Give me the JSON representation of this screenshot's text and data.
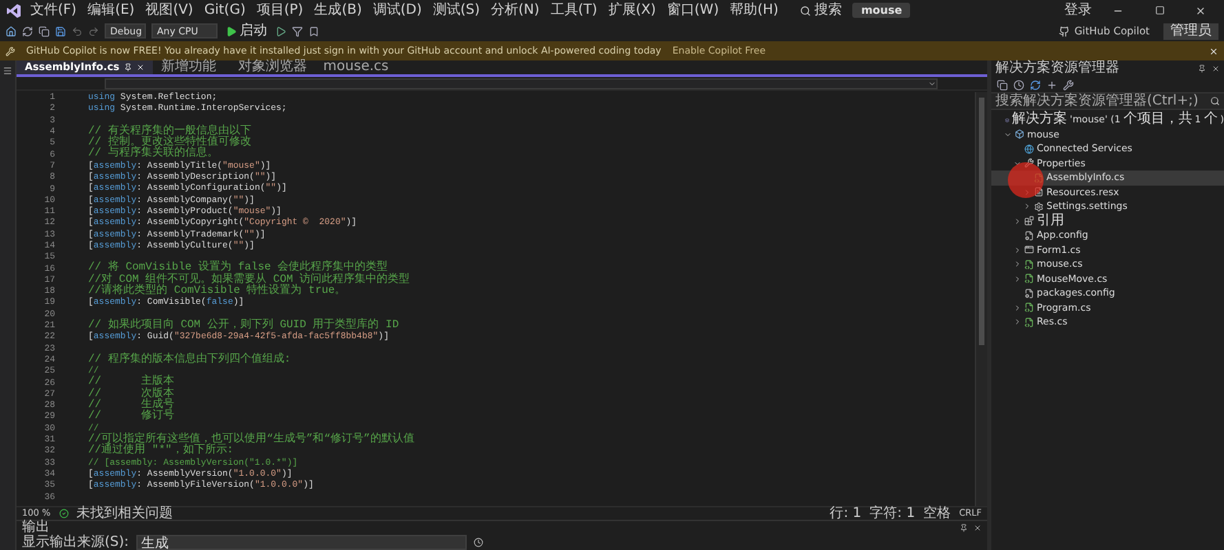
{
  "title_bar": {
    "menus": [
      "文件(F)",
      "编辑(E)",
      "视图(V)",
      "Git(G)",
      "项目(P)",
      "生成(B)",
      "调试(D)",
      "测试(S)",
      "分析(N)",
      "工具(T)",
      "扩展(X)",
      "窗口(W)",
      "帮助(H)"
    ],
    "search": "搜索",
    "solution_name": "mouse",
    "sign_in": "登录"
  },
  "toolbar": {
    "configuration": "Debug",
    "platform": "Any CPU",
    "start": "启动",
    "copilot": "GitHub Copilot",
    "admin": "管理员"
  },
  "banner": {
    "message": "GitHub Copilot is now FREE! You already have it installed just sign in with your GitHub account and unlock AI-powered coding today",
    "link": "Enable Copilot Free"
  },
  "editor": {
    "tabs": [
      {
        "label": "AssemblyInfo.cs",
        "selected": true
      },
      {
        "label": "新增功能",
        "selected": false
      },
      {
        "label": "对象浏览器",
        "selected": false
      },
      {
        "label": "mouse.cs",
        "selected": false
      }
    ],
    "lines": [
      {
        "number": "1",
        "segments": [
          {
            "kind": "keyword",
            "text": "using"
          },
          {
            "kind": "plain",
            "text": " System.Reflection;"
          }
        ]
      },
      {
        "number": "2",
        "segments": [
          {
            "kind": "keyword",
            "text": "using"
          },
          {
            "kind": "plain",
            "text": " System.Runtime.InteropServices;"
          }
        ]
      },
      {
        "number": "3"
      },
      {
        "number": "4",
        "segments": [
          {
            "kind": "comment",
            "text": "// 有关程序集的一般信息由以下"
          }
        ]
      },
      {
        "number": "5",
        "segments": [
          {
            "kind": "comment",
            "text": "// 控制。更改这些特性值可修改"
          }
        ]
      },
      {
        "number": "6",
        "segments": [
          {
            "kind": "comment",
            "text": "// 与程序集关联的信息。"
          }
        ]
      },
      {
        "number": "7",
        "segments": [
          {
            "kind": "plain",
            "text": "["
          },
          {
            "kind": "keyword",
            "text": "assembly"
          },
          {
            "kind": "plain",
            "text": ": AssemblyTitle("
          },
          {
            "kind": "string",
            "text": "\"mouse\""
          },
          {
            "kind": "plain",
            "text": ")]"
          }
        ]
      },
      {
        "number": "8",
        "segments": [
          {
            "kind": "plain",
            "text": "["
          },
          {
            "kind": "keyword",
            "text": "assembly"
          },
          {
            "kind": "plain",
            "text": ": AssemblyDescription("
          },
          {
            "kind": "string",
            "text": "\"\""
          },
          {
            "kind": "plain",
            "text": ")]"
          }
        ]
      },
      {
        "number": "9",
        "segments": [
          {
            "kind": "plain",
            "text": "["
          },
          {
            "kind": "keyword",
            "text": "assembly"
          },
          {
            "kind": "plain",
            "text": ": AssemblyConfiguration("
          },
          {
            "kind": "string",
            "text": "\"\""
          },
          {
            "kind": "plain",
            "text": ")]"
          }
        ]
      },
      {
        "number": "10",
        "segments": [
          {
            "kind": "plain",
            "text": "["
          },
          {
            "kind": "keyword",
            "text": "assembly"
          },
          {
            "kind": "plain",
            "text": ": AssemblyCompany("
          },
          {
            "kind": "string",
            "text": "\"\""
          },
          {
            "kind": "plain",
            "text": ")]"
          }
        ]
      },
      {
        "number": "11",
        "segments": [
          {
            "kind": "plain",
            "text": "["
          },
          {
            "kind": "keyword",
            "text": "assembly"
          },
          {
            "kind": "plain",
            "text": ": AssemblyProduct("
          },
          {
            "kind": "string",
            "text": "\"mouse\""
          },
          {
            "kind": "plain",
            "text": ")]"
          }
        ]
      },
      {
        "number": "12",
        "segments": [
          {
            "kind": "plain",
            "text": "["
          },
          {
            "kind": "keyword",
            "text": "assembly"
          },
          {
            "kind": "plain",
            "text": ": AssemblyCopyright("
          },
          {
            "kind": "string",
            "text": "\"Copyright ©  2020\""
          },
          {
            "kind": "plain",
            "text": ")]"
          }
        ]
      },
      {
        "number": "13",
        "segments": [
          {
            "kind": "plain",
            "text": "["
          },
          {
            "kind": "keyword",
            "text": "assembly"
          },
          {
            "kind": "plain",
            "text": ": AssemblyTrademark("
          },
          {
            "kind": "string",
            "text": "\"\""
          },
          {
            "kind": "plain",
            "text": ")]"
          }
        ]
      },
      {
        "number": "14",
        "segments": [
          {
            "kind": "plain",
            "text": "["
          },
          {
            "kind": "keyword",
            "text": "assembly"
          },
          {
            "kind": "plain",
            "text": ": AssemblyCulture("
          },
          {
            "kind": "string",
            "text": "\"\""
          },
          {
            "kind": "plain",
            "text": ")]"
          }
        ]
      },
      {
        "number": "15"
      },
      {
        "number": "16",
        "segments": [
          {
            "kind": "comment",
            "text": "// 将 ComVisible 设置为 false 会使此程序集中的类型"
          }
        ]
      },
      {
        "number": "17",
        "segments": [
          {
            "kind": "comment",
            "text": "//对 COM 组件不可见。如果需要从 COM 访问此程序集中的类型"
          }
        ]
      },
      {
        "number": "18",
        "segments": [
          {
            "kind": "comment",
            "text": "//请将此类型的 ComVisible 特性设置为 true。"
          }
        ]
      },
      {
        "number": "19",
        "segments": [
          {
            "kind": "plain",
            "text": "["
          },
          {
            "kind": "keyword",
            "text": "assembly"
          },
          {
            "kind": "plain",
            "text": ": ComVisible("
          },
          {
            "kind": "keyword",
            "text": "false"
          },
          {
            "kind": "plain",
            "text": ")]"
          }
        ]
      },
      {
        "number": "20"
      },
      {
        "number": "21",
        "segments": [
          {
            "kind": "comment",
            "text": "// 如果此项目向 COM 公开，则下列 GUID 用于类型库的 ID"
          }
        ]
      },
      {
        "number": "22",
        "segments": [
          {
            "kind": "plain",
            "text": "["
          },
          {
            "kind": "keyword",
            "text": "assembly"
          },
          {
            "kind": "plain",
            "text": ": Guid("
          },
          {
            "kind": "string",
            "text": "\"327be6d8-29a4-42f5-afda-fac5ff8bb4b8\""
          },
          {
            "kind": "plain",
            "text": ")]"
          }
        ]
      },
      {
        "number": "23"
      },
      {
        "number": "24",
        "segments": [
          {
            "kind": "comment",
            "text": "// 程序集的版本信息由下列四个值组成:"
          }
        ]
      },
      {
        "number": "25",
        "segments": [
          {
            "kind": "comment",
            "text": "//"
          }
        ]
      },
      {
        "number": "26",
        "segments": [
          {
            "kind": "comment",
            "text": "//      主版本"
          }
        ]
      },
      {
        "number": "27",
        "segments": [
          {
            "kind": "comment",
            "text": "//      次版本"
          }
        ]
      },
      {
        "number": "28",
        "segments": [
          {
            "kind": "comment",
            "text": "//      生成号"
          }
        ]
      },
      {
        "number": "29",
        "segments": [
          {
            "kind": "comment",
            "text": "//      修订号"
          }
        ]
      },
      {
        "number": "30",
        "segments": [
          {
            "kind": "comment",
            "text": "//"
          }
        ]
      },
      {
        "number": "31",
        "segments": [
          {
            "kind": "comment",
            "text": "//可以指定所有这些值，也可以使用“生成号”和“修订号”的默认值"
          }
        ]
      },
      {
        "number": "32",
        "segments": [
          {
            "kind": "comment",
            "text": "//通过使用 \"*\"，如下所示:"
          }
        ]
      },
      {
        "number": "33",
        "segments": [
          {
            "kind": "comment",
            "text": "// [assembly: AssemblyVersion(\"1.0.*\")]"
          }
        ]
      },
      {
        "number": "34",
        "segments": [
          {
            "kind": "plain",
            "text": "["
          },
          {
            "kind": "keyword",
            "text": "assembly"
          },
          {
            "kind": "plain",
            "text": ": AssemblyVersion("
          },
          {
            "kind": "string",
            "text": "\"1.0.0.0\""
          },
          {
            "kind": "plain",
            "text": ")]"
          }
        ]
      },
      {
        "number": "35",
        "segments": [
          {
            "kind": "plain",
            "text": "["
          },
          {
            "kind": "keyword",
            "text": "assembly"
          },
          {
            "kind": "plain",
            "text": ": AssemblyFileVersion("
          },
          {
            "kind": "string",
            "text": "\"1.0.0.0\""
          },
          {
            "kind": "plain",
            "text": ")]"
          }
        ]
      },
      {
        "number": "36"
      }
    ],
    "zoom": "100 %",
    "issues": "未找到相关问题",
    "line": "行: 1",
    "column": "字符: 1",
    "indent": "空格",
    "eol": "CRLF"
  },
  "solution_explorer": {
    "title": "解决方案资源管理器",
    "search_placeholder": "搜索解决方案资源管理器(Ctrl+;)",
    "tree": [
      {
        "label": "解决方案 'mouse' (1 个项目，共 1 个)",
        "kind": "solution",
        "selected": false,
        "children": [
          {
            "label": "mouse",
            "kind": "project",
            "expanded": true,
            "selected": false,
            "children": [
              {
                "label": "Connected Services",
                "kind": "services",
                "selected": false
              },
              {
                "label": "Properties",
                "kind": "properties",
                "expanded": true,
                "selected": false,
                "children": [
                  {
                    "label": "AssemblyInfo.cs",
                    "kind": "cs",
                    "selected": true
                  },
                  {
                    "label": "Resources.resx",
                    "kind": "resx",
                    "expanded": false,
                    "selected": false
                  },
                  {
                    "label": "Settings.settings",
                    "kind": "settings",
                    "expanded": false,
                    "selected": false
                  }
                ]
              },
              {
                "label": "引用",
                "kind": "references",
                "expanded": false,
                "selected": false
              },
              {
                "label": "App.config",
                "kind": "config",
                "selected": false
              },
              {
                "label": "Form1.cs",
                "kind": "form",
                "expanded": false,
                "selected": false
              },
              {
                "label": "mouse.cs",
                "kind": "cs",
                "expanded": false,
                "selected": false
              },
              {
                "label": "MouseMove.cs",
                "kind": "cs",
                "expanded": false,
                "selected": false
              },
              {
                "label": "packages.config",
                "kind": "config",
                "selected": false
              },
              {
                "label": "Program.cs",
                "kind": "cs",
                "expanded": false,
                "selected": false
              },
              {
                "label": "Res.cs",
                "kind": "cs",
                "expanded": false,
                "selected": false
              }
            ]
          }
        ]
      }
    ]
  },
  "output": {
    "title": "输出",
    "source_label": "显示输出来源(S):",
    "source": "生成"
  }
}
